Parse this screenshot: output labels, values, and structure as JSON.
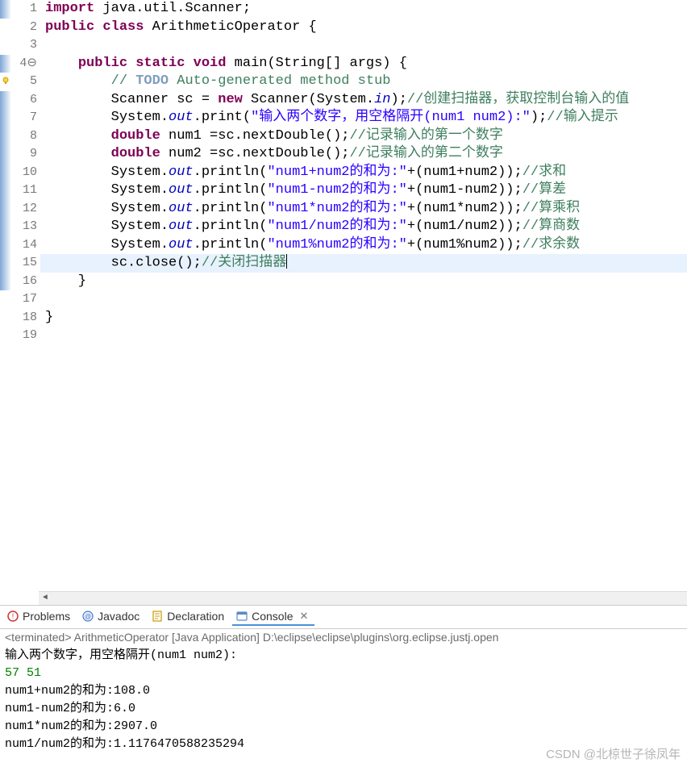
{
  "code": {
    "lines": [
      {
        "n": "1",
        "marker": "fold",
        "segs": [
          [
            "kw",
            "import"
          ],
          [
            "",
            " java.util.Scanner;"
          ]
        ]
      },
      {
        "n": "2",
        "segs": [
          [
            "kw",
            "public"
          ],
          [
            "",
            " "
          ],
          [
            "kw",
            "class"
          ],
          [
            "",
            " ArithmeticOperator {"
          ]
        ]
      },
      {
        "n": "3",
        "segs": [
          [
            "",
            ""
          ]
        ]
      },
      {
        "n": "4⊖",
        "marker": "fold",
        "segs": [
          [
            "",
            "    "
          ],
          [
            "kw",
            "public"
          ],
          [
            "",
            " "
          ],
          [
            "kw",
            "static"
          ],
          [
            "",
            " "
          ],
          [
            "kw",
            "void"
          ],
          [
            "",
            " main(String[] args) {"
          ]
        ]
      },
      {
        "n": "5",
        "marker": "bulb",
        "segs": [
          [
            "",
            "        "
          ],
          [
            "cmt",
            "// "
          ],
          [
            "todo",
            "TODO"
          ],
          [
            "cmt",
            " Auto-generated method stub"
          ]
        ]
      },
      {
        "n": "6",
        "marker": "fold",
        "segs": [
          [
            "",
            "        Scanner sc = "
          ],
          [
            "kw",
            "new"
          ],
          [
            "",
            " Scanner(System."
          ],
          [
            "fld",
            "in"
          ],
          [
            "",
            ");"
          ],
          [
            "cmt",
            "//创建扫描器，获取控制台输入的值"
          ]
        ]
      },
      {
        "n": "7",
        "marker": "fold",
        "segs": [
          [
            "",
            "        System."
          ],
          [
            "fld",
            "out"
          ],
          [
            "",
            ".print("
          ],
          [
            "str",
            "\"输入两个数字，用空格隔开(num1 num2):\""
          ],
          [
            "",
            ");"
          ],
          [
            "cmt",
            "//输入提示"
          ]
        ]
      },
      {
        "n": "8",
        "marker": "fold",
        "segs": [
          [
            "",
            "        "
          ],
          [
            "kw",
            "double"
          ],
          [
            "",
            " num1 =sc.nextDouble();"
          ],
          [
            "cmt",
            "//记录输入的第一个数字"
          ]
        ]
      },
      {
        "n": "9",
        "marker": "fold",
        "segs": [
          [
            "",
            "        "
          ],
          [
            "kw",
            "double"
          ],
          [
            "",
            " num2 =sc.nextDouble();"
          ],
          [
            "cmt",
            "//记录输入的第二个数字"
          ]
        ]
      },
      {
        "n": "10",
        "marker": "fold",
        "segs": [
          [
            "",
            "        System."
          ],
          [
            "fld",
            "out"
          ],
          [
            "",
            ".println("
          ],
          [
            "str",
            "\"num1+num2的和为:\""
          ],
          [
            "",
            "+(num1+num2));"
          ],
          [
            "cmt",
            "//求和"
          ]
        ]
      },
      {
        "n": "11",
        "marker": "fold",
        "segs": [
          [
            "",
            "        System."
          ],
          [
            "fld",
            "out"
          ],
          [
            "",
            ".println("
          ],
          [
            "str",
            "\"num1-num2的和为:\""
          ],
          [
            "",
            "+(num1-num2));"
          ],
          [
            "cmt",
            "//算差"
          ]
        ]
      },
      {
        "n": "12",
        "marker": "fold",
        "segs": [
          [
            "",
            "        System."
          ],
          [
            "fld",
            "out"
          ],
          [
            "",
            ".println("
          ],
          [
            "str",
            "\"num1*num2的和为:\""
          ],
          [
            "",
            "+(num1*num2));"
          ],
          [
            "cmt",
            "//算乘积"
          ]
        ]
      },
      {
        "n": "13",
        "marker": "fold",
        "segs": [
          [
            "",
            "        System."
          ],
          [
            "fld",
            "out"
          ],
          [
            "",
            ".println("
          ],
          [
            "str",
            "\"num1/num2的和为:\""
          ],
          [
            "",
            "+(num1/num2));"
          ],
          [
            "cmt",
            "//算商数"
          ]
        ]
      },
      {
        "n": "14",
        "marker": "fold",
        "segs": [
          [
            "",
            "        System."
          ],
          [
            "fld",
            "out"
          ],
          [
            "",
            ".println("
          ],
          [
            "str",
            "\"num1%num2的和为:\""
          ],
          [
            "",
            "+(num1%num2));"
          ],
          [
            "cmt",
            "//求余数"
          ]
        ]
      },
      {
        "n": "15",
        "marker": "fold",
        "hl": true,
        "cursor": true,
        "segs": [
          [
            "",
            "        sc.close();"
          ],
          [
            "cmt",
            "//关闭扫描器"
          ]
        ]
      },
      {
        "n": "16",
        "marker": "fold",
        "segs": [
          [
            "",
            "    }"
          ]
        ]
      },
      {
        "n": "17",
        "segs": [
          [
            "",
            ""
          ]
        ]
      },
      {
        "n": "18",
        "segs": [
          [
            "",
            "}"
          ]
        ]
      },
      {
        "n": "19",
        "segs": [
          [
            "",
            ""
          ]
        ]
      }
    ]
  },
  "tabs": {
    "problems": "Problems",
    "javadoc": "Javadoc",
    "declaration": "Declaration",
    "console": "Console"
  },
  "console": {
    "terminated": "<terminated> ArithmeticOperator [Java Application] D:\\eclipse\\eclipse\\plugins\\org.eclipse.justj.open",
    "prompt": "输入两个数字，用空格隔开(num1 num2):",
    "input": "57 51",
    "out1": "num1+num2的和为:108.0",
    "out2": "num1-num2的和为:6.0",
    "out3": "num1*num2的和为:2907.0",
    "out4": "num1/num2的和为:1.1176470588235294"
  },
  "watermark": "CSDN @北椋世子徐凤年"
}
